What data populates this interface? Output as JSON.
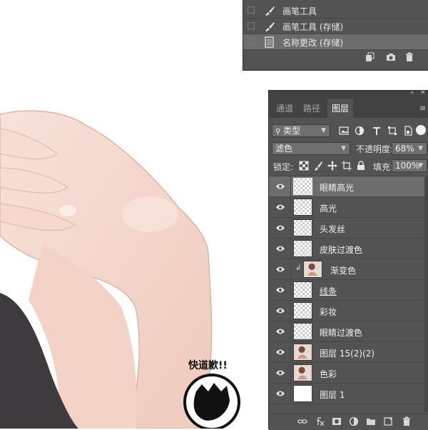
{
  "history": {
    "items": [
      {
        "label": "画笔工具",
        "icon": "brush-icon",
        "selected": false
      },
      {
        "label": "画笔工具 (存储)",
        "icon": "brush-icon",
        "selected": false
      },
      {
        "label": "名称更改 (存储)",
        "icon": "document-icon",
        "selected": true
      }
    ],
    "footer_icons": [
      "new-document-from-state-icon",
      "camera-icon",
      "trash-icon"
    ]
  },
  "layers_panel": {
    "tabs": [
      {
        "label": "通道",
        "active": false
      },
      {
        "label": "路径",
        "active": false
      },
      {
        "label": "图层",
        "active": true
      }
    ],
    "filter_label": "类型",
    "blend_mode": "滤色",
    "opacity_label": "不透明度:",
    "opacity_value": "68%",
    "lock_label": "锁定:",
    "fill_label": "填充:",
    "fill_value": "100%",
    "layers": [
      {
        "name": "眼睛高光",
        "thumb": "transparent",
        "selected": true,
        "clipped": false
      },
      {
        "name": "高光",
        "thumb": "transparent",
        "selected": false,
        "clipped": false
      },
      {
        "name": "头发丝",
        "thumb": "transparent",
        "selected": false,
        "clipped": false
      },
      {
        "name": "皮肤过渡色",
        "thumb": "transparent",
        "selected": false,
        "clipped": false
      },
      {
        "name": "渐变色",
        "thumb": "photo",
        "selected": false,
        "clipped": true
      },
      {
        "name": "线条",
        "thumb": "transparent",
        "selected": false,
        "clipped": false
      },
      {
        "name": "彩妆",
        "thumb": "transparent",
        "selected": false,
        "clipped": false
      },
      {
        "name": "眼睛过渡色",
        "thumb": "transparent",
        "selected": false,
        "clipped": false
      },
      {
        "name": "图层 15(2)(2)",
        "thumb": "photo",
        "selected": false,
        "clipped": false
      },
      {
        "name": "色彩",
        "thumb": "photo",
        "selected": false,
        "clipped": false
      },
      {
        "name": "图层 1",
        "thumb": "white",
        "selected": false,
        "clipped": false
      }
    ],
    "footer_icons": [
      "link-icon",
      "fx-icon",
      "mask-icon",
      "adjustment-icon",
      "folder-icon",
      "new-layer-icon",
      "trash-icon"
    ]
  },
  "canvas": {
    "watermark_text": "快道歉!!",
    "colors": {
      "skin": "#f3d6cb",
      "skin_shadow": "#e6b8ab",
      "dark_cloth": "#3e3a3d"
    }
  },
  "colors": {
    "panel_bg": "#535353",
    "panel_dark": "#424242",
    "selected_row": "#6d6d6d"
  }
}
